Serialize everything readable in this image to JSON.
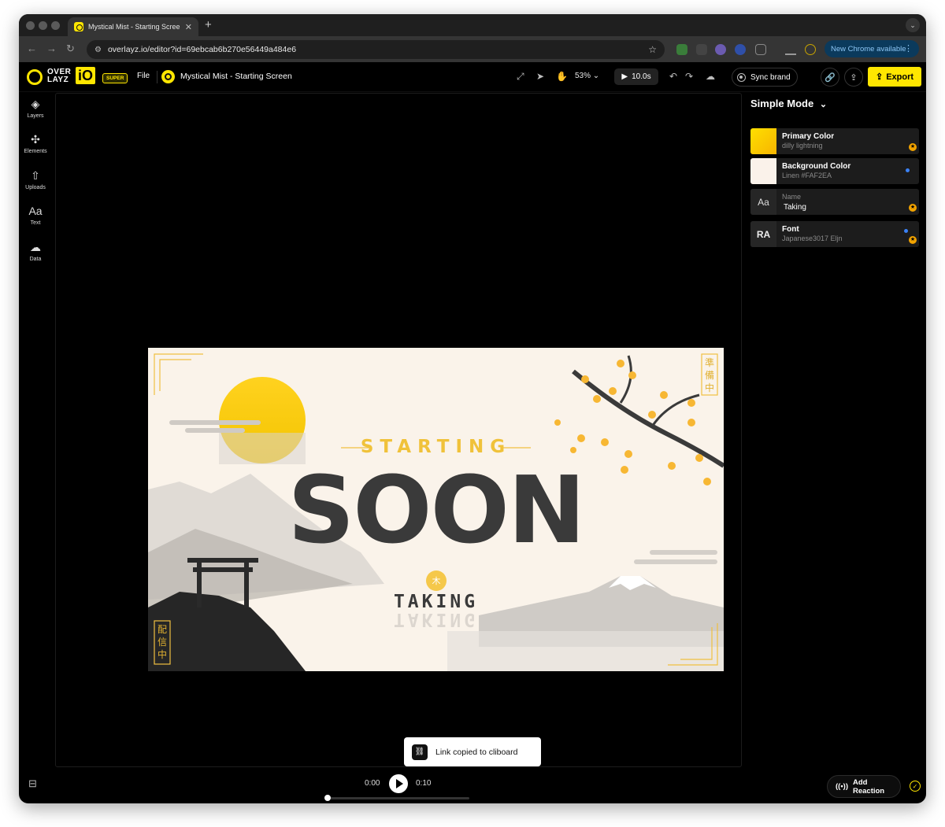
{
  "browser": {
    "tab_title": "Mystical Mist - Starting Scree",
    "url": "overlayz.io/editor?id=69ebcab6b270e56449a484e6",
    "update_label": "New Chrome available"
  },
  "header": {
    "logo_text_1": "OVER",
    "logo_text_2": "LAYZ",
    "logo_io": "iO",
    "plan_badge": "SUPER",
    "file_menu": "File",
    "project_title": "Mystical Mist - Starting Screen",
    "zoom": "53%",
    "duration": "10.0s",
    "sync_label": "Sync brand",
    "export_label": "Export"
  },
  "sidebar": {
    "items": [
      {
        "label": "Layers",
        "icon": "layers-icon"
      },
      {
        "label": "Elements",
        "icon": "elements-icon"
      },
      {
        "label": "Uploads",
        "icon": "upload-icon"
      },
      {
        "label": "Text",
        "icon": "text-icon"
      },
      {
        "label": "Data",
        "icon": "data-icon"
      }
    ]
  },
  "artboard": {
    "heading_small": "STARTING",
    "heading_big": "SOON",
    "subtitle": "TAKING",
    "left_kanji": "配信中",
    "right_kanji": "準備中",
    "emblem_kanji": "木"
  },
  "panel": {
    "mode_label": "Simple Mode",
    "cards": [
      {
        "title": "Primary Color",
        "subtitle": "dilly lightning",
        "color": "#ffd000"
      },
      {
        "title": "Background Color",
        "subtitle": "Linen #FAF2EA",
        "color": "#FAF2EA"
      },
      {
        "title": "Name",
        "subtitle": "Taking",
        "icon_text": "Aa"
      },
      {
        "title": "Font",
        "subtitle": "Japanese3017 Eljn",
        "icon_text": "RA"
      }
    ]
  },
  "toast": {
    "message": "Link copied to cliboard"
  },
  "player": {
    "current": "0:00",
    "total": "0:10",
    "progress": 0
  },
  "footer": {
    "reaction_label": "Add Reaction"
  },
  "colors": {
    "accent": "#ffe600",
    "canvas_bg": "#000000",
    "panel_card": "#1c1c1c"
  }
}
